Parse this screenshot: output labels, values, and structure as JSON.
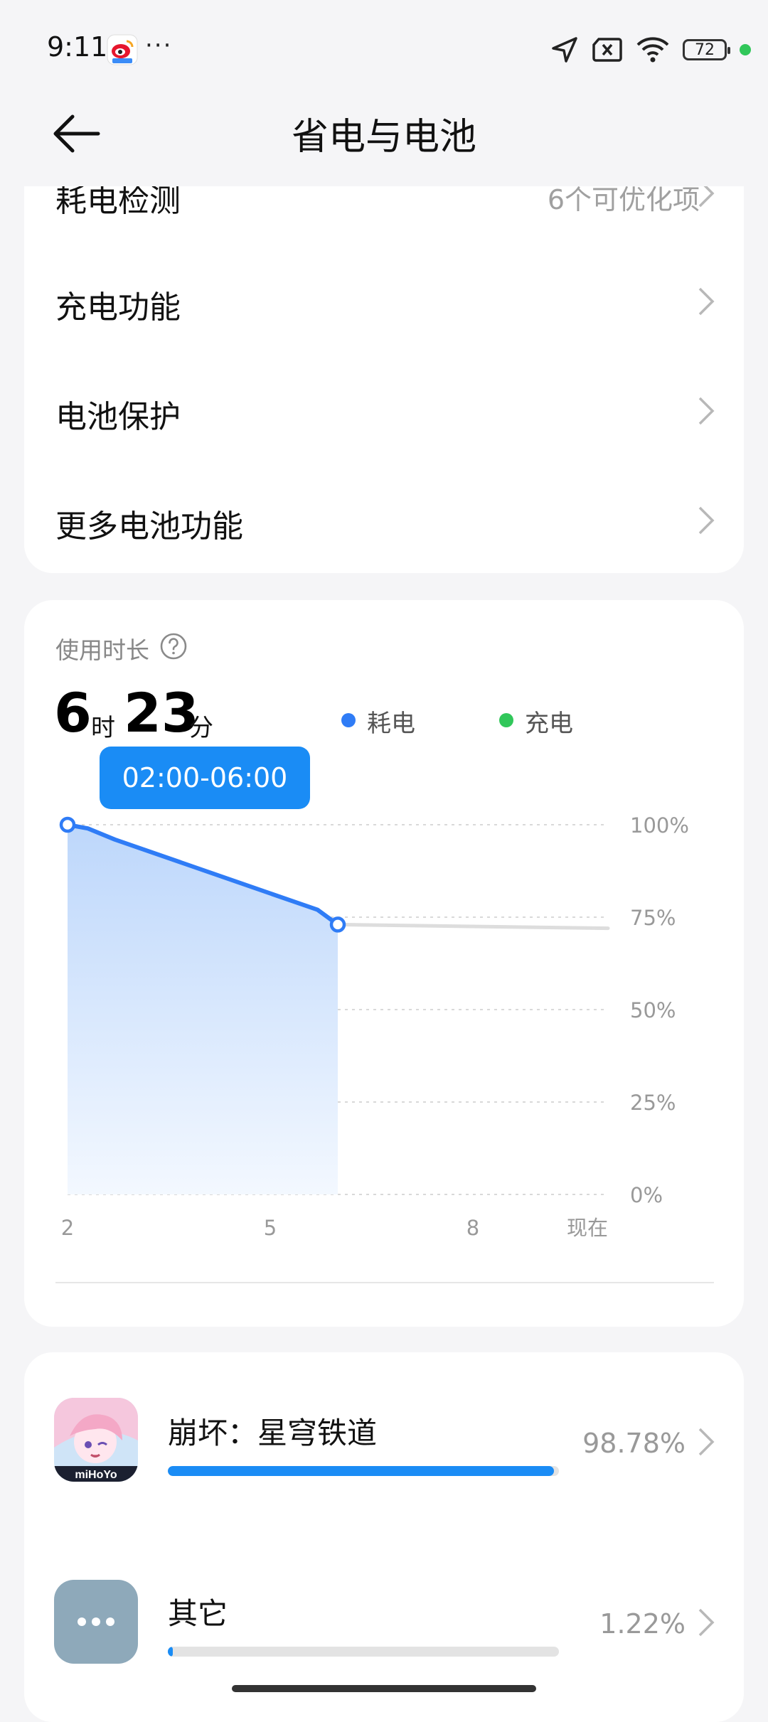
{
  "status": {
    "time": "9:11",
    "more": "···",
    "battery": "72"
  },
  "header": {
    "title": "省电与电池",
    "back_icon": "back-arrow-icon"
  },
  "menu": [
    {
      "label": "耗电检测",
      "value": "6个可优化项"
    },
    {
      "label": "充电功能",
      "value": ""
    },
    {
      "label": "电池保护",
      "value": ""
    },
    {
      "label": "更多电池功能",
      "value": ""
    }
  ],
  "usage": {
    "title": "使用时长",
    "hours": "6",
    "hours_unit": "时",
    "minutes": "23",
    "minutes_unit": "分",
    "legend": [
      {
        "label": "耗电",
        "color": "#2f7cf6"
      },
      {
        "label": "充电",
        "color": "#31c75a"
      }
    ],
    "tooltip": "02:00-06:00"
  },
  "chart_data": {
    "type": "area",
    "x_ticks": [
      "2",
      "5",
      "8",
      "现在"
    ],
    "y_ticks": [
      "100%",
      "75%",
      "50%",
      "25%",
      "0%"
    ],
    "ylim": [
      0,
      100
    ],
    "series": [
      {
        "name": "耗电",
        "x": [
          2,
          2.3,
          2.7,
          5.7,
          6.0
        ],
        "values": [
          100,
          99,
          96,
          77,
          73
        ],
        "color": "#2f7cf6"
      }
    ],
    "projection": {
      "x": [
        6.0,
        10.0
      ],
      "values": [
        73,
        72
      ],
      "color": "#dddddd"
    },
    "highlight_range": [
      "02:00",
      "06:00"
    ]
  },
  "apps": [
    {
      "name": "崩坏：星穹铁道",
      "percent": "98.78%",
      "fraction": 0.9878,
      "icon": "honkai-star-rail-app-icon"
    },
    {
      "name": "其它",
      "percent": "1.22%",
      "fraction": 0.0122,
      "icon": "more-dots-icon"
    }
  ]
}
